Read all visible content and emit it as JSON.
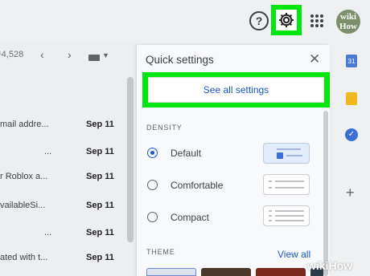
{
  "header": {
    "help_icon": "question-circle-icon",
    "help_glyph": "?",
    "settings_icon": "gear-icon",
    "apps_icon": "apps-grid-icon",
    "avatar_line1": "wiki",
    "avatar_line2": "How"
  },
  "inbox": {
    "count": "4,528",
    "prev_glyph": "‹",
    "next_glyph": "›",
    "rows": [
      {
        "snippet": "mail addre...",
        "date": "Sep 11"
      },
      {
        "snippet": "...",
        "date": "Sep 11"
      },
      {
        "snippet": "r Roblox a...",
        "date": "Sep 11"
      },
      {
        "snippet": "vailableSi...",
        "date": "Sep 11"
      },
      {
        "snippet": "...",
        "date": "Sep 11"
      },
      {
        "snippet": "ated with t...",
        "date": "Sep 11"
      }
    ]
  },
  "quick_settings": {
    "title": "Quick settings",
    "close_glyph": "✕",
    "see_all_label": "See all settings",
    "density_label": "DENSITY",
    "density_options": [
      {
        "label": "Default",
        "selected": true
      },
      {
        "label": "Comfortable",
        "selected": false
      },
      {
        "label": "Compact",
        "selected": false
      }
    ],
    "theme_label": "THEME",
    "view_all_label": "View all"
  },
  "rail": {
    "calendar_text": "31",
    "tasks_glyph": "✓",
    "plus_glyph": "+"
  },
  "watermark": "wikiHow",
  "colors": {
    "highlight": "#00e60e",
    "link": "#1a56c9"
  }
}
